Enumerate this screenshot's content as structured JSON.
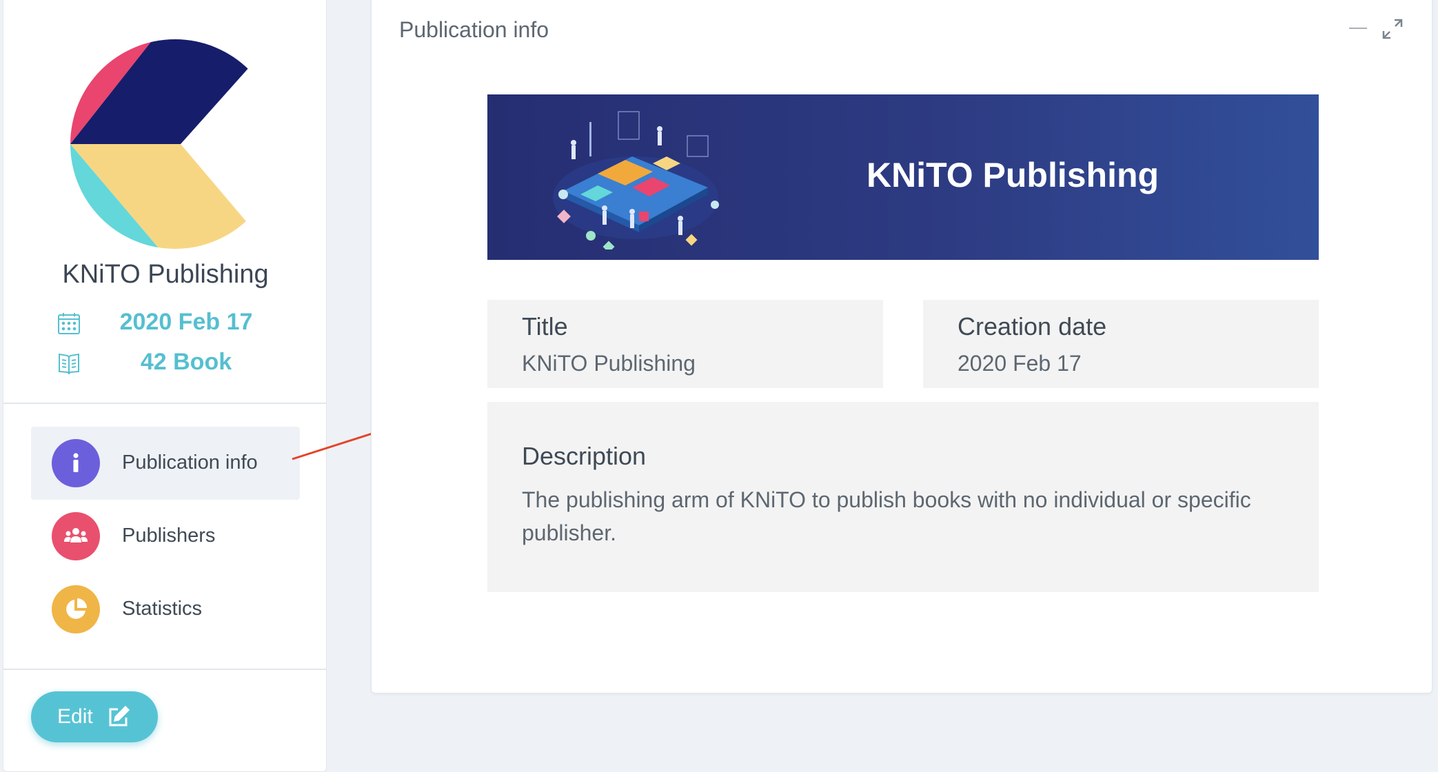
{
  "sidebar": {
    "publisher_name": "KNiTO Publishing",
    "creation_date": "2020 Feb 17",
    "book_count": "42 Book",
    "nav": [
      {
        "label": "Publication info",
        "icon": "info-icon",
        "color": "#6c5fdc",
        "active": true
      },
      {
        "label": "Publishers",
        "icon": "users-icon",
        "color": "#e9506d",
        "active": false
      },
      {
        "label": "Statistics",
        "icon": "pie-chart-icon",
        "color": "#f0b547",
        "active": false
      }
    ],
    "edit_label": "Edit",
    "edit_icon": "edit-icon"
  },
  "main": {
    "card_title": "Publication info",
    "banner_title": "KNiTO Publishing",
    "title_label": "Title",
    "title_value": "KNiTO Publishing",
    "date_label": "Creation date",
    "date_value": "2020 Feb 17",
    "description_label": "Description",
    "description_value": "The publishing arm of KNiTO to publish books with no individual or specific publisher."
  },
  "colors": {
    "accent": "#56c3d4",
    "banner_start": "#262e72",
    "banner_end": "#324f9a",
    "annotation_arrow": "#e5432a"
  }
}
